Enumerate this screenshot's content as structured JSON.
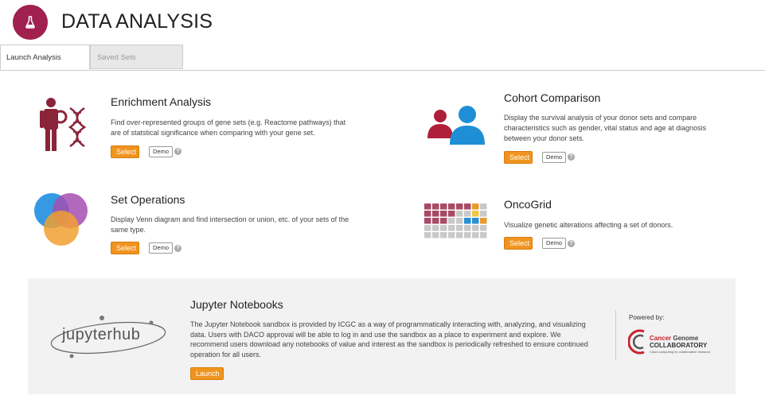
{
  "header": {
    "title": "DATA ANALYSIS",
    "icon": "flask-icon",
    "accent": "#a0204e"
  },
  "tabs": [
    {
      "label": "Launch Analysis",
      "active": true
    },
    {
      "label": "Saved Sets",
      "active": false
    }
  ],
  "cards": {
    "enrichment": {
      "title": "Enrichment Analysis",
      "description": "Find over-represented groups of gene sets (e.g. Reactome pathways) that are of statstical significance when comparing with your gene set.",
      "select_label": "Select",
      "demo_label": "Demo",
      "help": "?"
    },
    "cohort": {
      "title": "Cohort Comparison",
      "description": "Display the survival analysis of your donor sets and compare characteristics such as gender, vital status and age at diagnosis between your donor sets.",
      "select_label": "Select",
      "demo_label": "Demo",
      "help": "?"
    },
    "setops": {
      "title": "Set Operations",
      "description": "Display Venn diagram and find intersection or union, etc. of your sets of the same type.",
      "select_label": "Select",
      "demo_label": "Demo",
      "help": "?"
    },
    "oncogrid": {
      "title": "OncoGrid",
      "description": "Visualize genetic alterations affecting a set of donors.",
      "select_label": "Select",
      "demo_label": "Demo",
      "help": "?"
    }
  },
  "jupyter": {
    "logo_text": "jupyterhub",
    "title": "Jupyter Notebooks",
    "description": "The Jupyter Notebook sandbox is provided by ICGC as a way of programmatically interacting with, analyzing, and visualizing data. Users with DACO approval will be able to log in and use the sandbox as a place to experiment and explore. We recommend users download any notebooks of value and interest as the sandbox is periodically refreshed to ensure continued operation for all users.",
    "launch_label": "Launch",
    "powered_by": "Powered by:",
    "partner_line1a": "Cancer",
    "partner_line1b": "Genome",
    "partner_line2": "COLLABORATORY",
    "partner_tagline": "Cloud computing for collaborative research"
  },
  "colors": {
    "button": "#f0941f",
    "brand": "#a0204e",
    "panel": "#f2f2f2"
  }
}
